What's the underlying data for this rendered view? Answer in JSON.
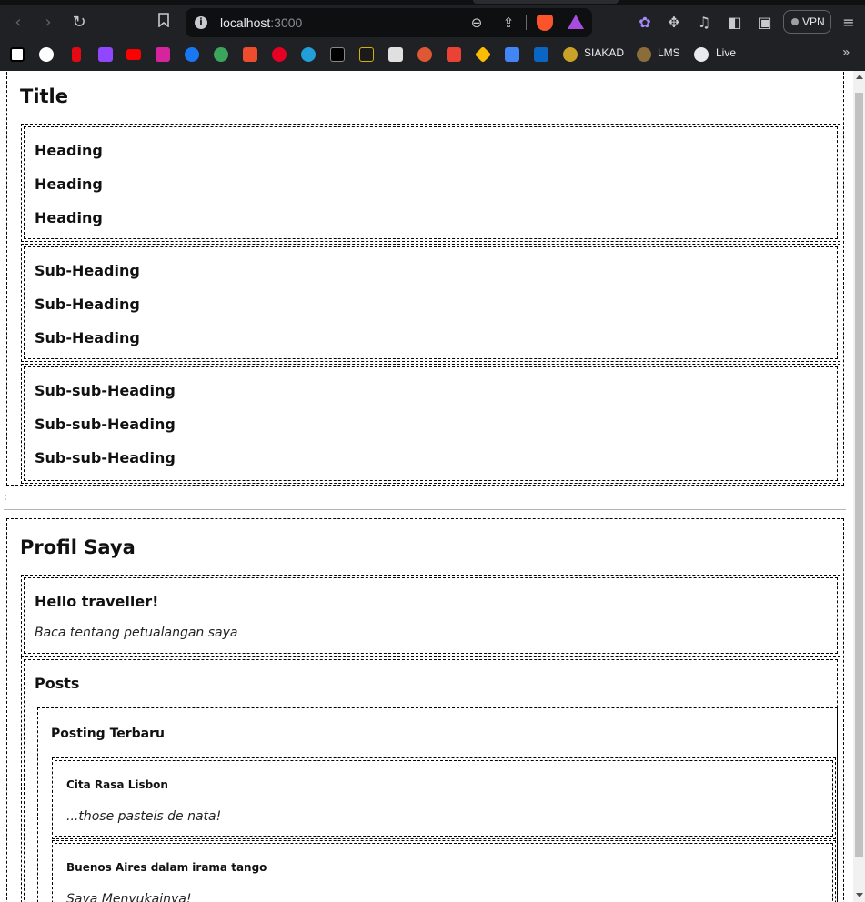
{
  "browser": {
    "url_host": "localhost",
    "url_port": ":3000",
    "vpn_label": "VPN",
    "nav": {
      "back_icon": "‹",
      "forward_icon": "›",
      "reload_icon": "↻"
    },
    "bookmarks_labels": {
      "siakad": "SIAKAD",
      "lms": "LMS",
      "live": "Live"
    },
    "more_icon": "»"
  },
  "page": {
    "section1": {
      "title": "Title",
      "headings": [
        "Heading",
        "Heading",
        "Heading"
      ],
      "subheadings": [
        "Sub-Heading",
        "Sub-Heading",
        "Sub-Heading"
      ],
      "subsubheadings": [
        "Sub-sub-Heading",
        "Sub-sub-Heading",
        "Sub-sub-Heading"
      ]
    },
    "stray_text": ";",
    "section2": {
      "title": "Profil Saya",
      "greeting": "Hello traveller!",
      "greeting_sub": "Baca tentang petualangan saya",
      "posts_title": "Posts",
      "latest_title": "Posting Terbaru",
      "posts": [
        {
          "title": "Cita Rasa Lisbon",
          "excerpt": "...those pasteis de nata!"
        },
        {
          "title": "Buenos Aires dalam irama tango",
          "excerpt": "Saya Menyukainya!"
        }
      ]
    }
  },
  "colors": {
    "chrome_bg": "#202124",
    "omnibox_bg": "#0e0f11",
    "page_bg": "#ffffff"
  }
}
